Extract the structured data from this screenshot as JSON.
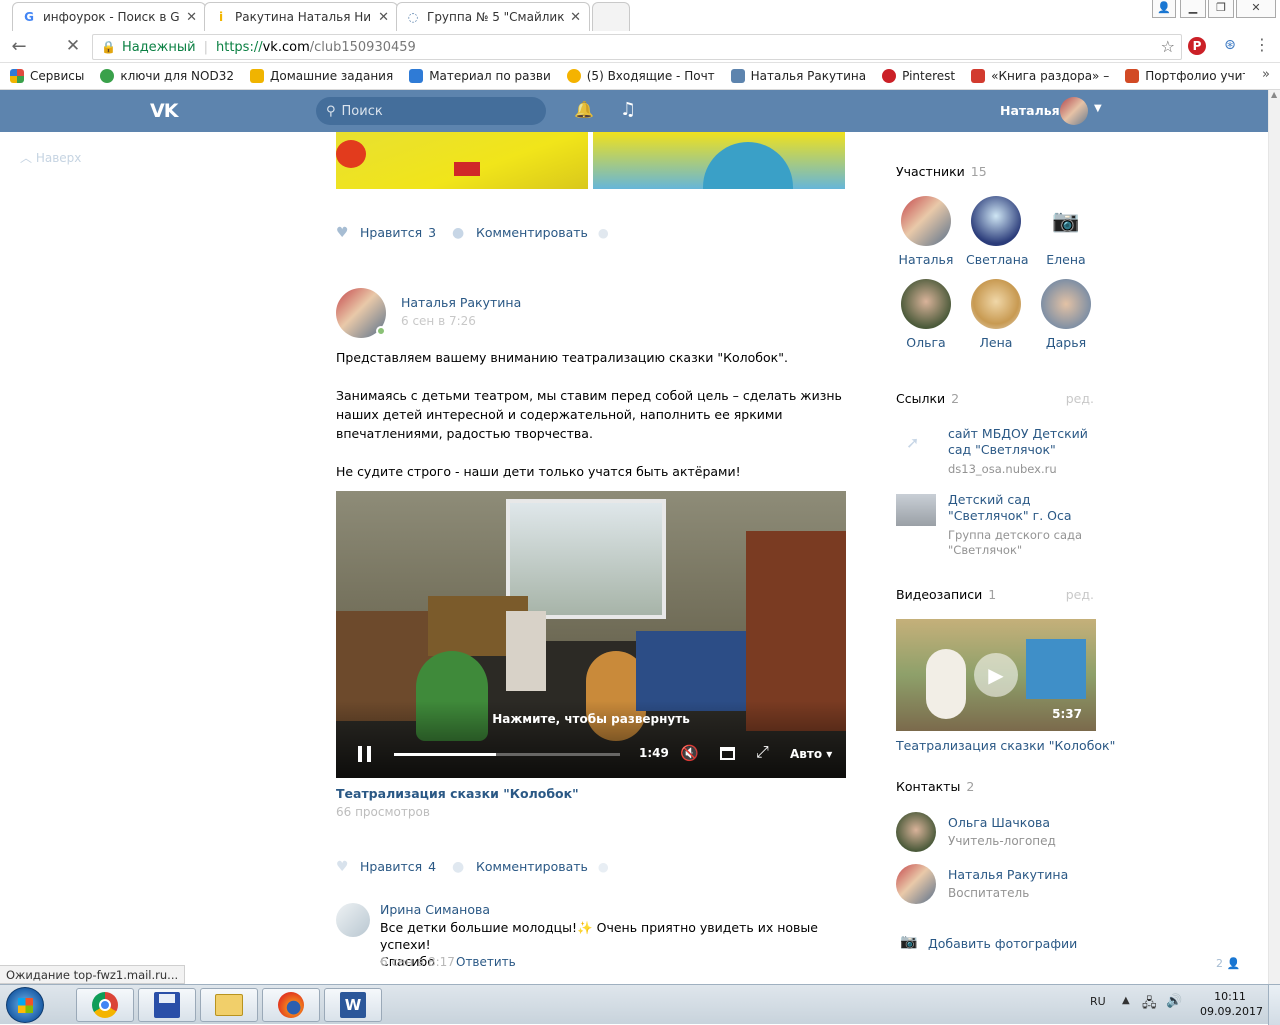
{
  "browser": {
    "tabs": [
      {
        "title": "инфоурок - Поиск в Go",
        "icon_color": "#4285f4"
      },
      {
        "title": "Ракутина Наталья Нико",
        "icon_color": "#f2b600"
      },
      {
        "title": "Группа № 5 \"Смайлик\"",
        "icon_color": "#5d84ae"
      }
    ],
    "secure_label": "Надежный",
    "url_scheme": "https://",
    "url_host": "vk.com",
    "url_path": "/club150930459",
    "bookmarks": [
      {
        "label": "Сервисы",
        "color": "#e04a3f"
      },
      {
        "label": "ключи для NOD32",
        "color": "#3aa14b"
      },
      {
        "label": "Домашние задания",
        "color": "#f0b400"
      },
      {
        "label": "Материал по разви",
        "color": "#2f7bd6"
      },
      {
        "label": "(5) Входящие - Почт",
        "color": "#f5b300"
      },
      {
        "label": "Наталья Ракутина",
        "color": "#5d84ae"
      },
      {
        "label": "Pinterest",
        "color": "#cb2027"
      },
      {
        "label": "«Книга раздора» – ",
        "color": "#d23b2f"
      },
      {
        "label": "Портфолио учителе",
        "color": "#d24a25"
      }
    ],
    "status_text": "Ожидание top-fwz1.mail.ru..."
  },
  "vk": {
    "search_placeholder": "Поиск",
    "user_name": "Наталья",
    "back_to_top": "Наверх",
    "post1": {
      "like_label": "Нравится",
      "like_count": "3",
      "comment_label": "Комментировать"
    },
    "post2": {
      "author": "Наталья Ракутина",
      "date": "6 сен в 7:26",
      "p1": "Представляем вашему вниманию театрализацию сказки \"Колобок\".",
      "p2": "Занимаясь с детьми театром, мы ставим перед собой цель – сделать жизнь наших детей интересной и содержательной, наполнить ее яркими впечатлениями, радостью творчества.",
      "p3": "Не судите строго - наши дети только учатся быть актёрами!",
      "video_hint": "Нажмите, чтобы развернуть",
      "video_time": "1:49",
      "video_quality": "Авто",
      "video_progress": 0.45,
      "video_title": "Театрализация сказки \"Колобок\"",
      "video_views": "66 просмотров",
      "like_label": "Нравится",
      "like_count": "4",
      "comment_label": "Комментировать"
    },
    "comment": {
      "author": "Ирина Симанова",
      "text": "Все детки большие молодцы!",
      "text2": "Очень приятно увидеть их новые успехи!",
      "text3": "Спасибо",
      "date": "6 сен в 8:17",
      "reply": "Ответить"
    },
    "members": {
      "title": "Участники",
      "count": "15",
      "list": [
        "Наталья",
        "Светлана",
        "Елена",
        "Ольга",
        "Лена",
        "Дарья"
      ]
    },
    "links": {
      "title": "Ссылки",
      "count": "2",
      "edit": "ред.",
      "items": [
        {
          "title": "сайт МБДОУ Детский сад \"Светлячок\"",
          "sub": "ds13_osa.nubex.ru"
        },
        {
          "title": "Детский сад \"Светлячок\" г. Оса",
          "sub": "Группа детского сада \"Светлячок\""
        }
      ]
    },
    "videos": {
      "title": "Видеозаписи",
      "count": "1",
      "edit": "ред.",
      "duration": "5:37",
      "item_title": "Театрализация сказки \"Колобок\""
    },
    "contacts": {
      "title": "Контакты",
      "count": "2",
      "items": [
        {
          "name": "Ольга Шачкова",
          "role": "Учитель-логопед"
        },
        {
          "name": "Наталья Ракутина",
          "role": "Воспитатель"
        }
      ]
    },
    "add_photos": "Добавить фотографии",
    "online_count": "2"
  },
  "taskbar": {
    "lang": "RU",
    "time": "10:11",
    "date": "09.09.2017"
  }
}
